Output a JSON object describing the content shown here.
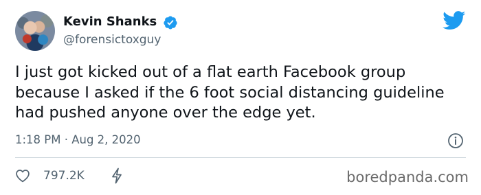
{
  "tweet": {
    "author_name": "Kevin Shanks",
    "author_handle": "@forensictoxguy",
    "text": "I just got kicked out of a flat earth Facebook group because I asked if the 6 foot social distancing guideline had pushed anyone over the edge yet.",
    "timestamp": "1:18 PM · Aug 2, 2020",
    "like_count": "797.2K"
  },
  "icons": {
    "verified": "verified-badge-icon",
    "brand": "twitter-bird-icon",
    "info": "info-icon",
    "like": "heart-icon",
    "extra": "bolt-icon"
  },
  "colors": {
    "brand_blue": "#1d9bf0",
    "secondary_text": "#536471",
    "divider": "#cfd9de"
  },
  "watermark": "boredpanda.com"
}
